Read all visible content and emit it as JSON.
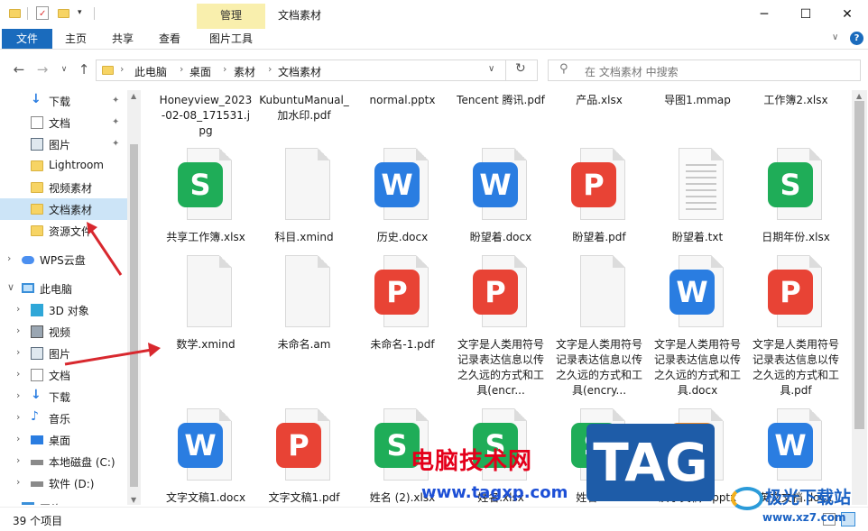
{
  "titlebar": {
    "window_title": "文档素材",
    "context_tab": "管理",
    "controls": {
      "minimize": "─",
      "maximize": "☐",
      "close": "✕"
    }
  },
  "ribbon": {
    "tabs": [
      "文件",
      "主页",
      "共享",
      "查看",
      "图片工具"
    ],
    "help_icon": "?"
  },
  "address": {
    "crumbs": [
      "此电脑",
      "桌面",
      "素材",
      "文档素材"
    ],
    "search_placeholder": "在 文档素材 中搜索"
  },
  "nav": {
    "quick": [
      {
        "label": "下载",
        "icon": "download-icon",
        "pinned": true
      },
      {
        "label": "文档",
        "icon": "document-icon",
        "pinned": true
      },
      {
        "label": "图片",
        "icon": "picture-icon",
        "pinned": true
      },
      {
        "label": "Lightroom",
        "icon": "folder-icon"
      },
      {
        "label": "视频素材",
        "icon": "folder-icon"
      },
      {
        "label": "文档素材",
        "icon": "folder-icon",
        "selected": true
      },
      {
        "label": "资源文件",
        "icon": "folder-icon"
      }
    ],
    "wps": "WPS云盘",
    "pc": "此电脑",
    "pc_items": [
      {
        "label": "3D 对象",
        "icon": "3d-objects-icon"
      },
      {
        "label": "视频",
        "icon": "video-icon"
      },
      {
        "label": "图片",
        "icon": "picture-icon"
      },
      {
        "label": "文档",
        "icon": "document-icon"
      },
      {
        "label": "下载",
        "icon": "download-icon"
      },
      {
        "label": "音乐",
        "icon": "music-icon"
      },
      {
        "label": "桌面",
        "icon": "desktop-icon"
      },
      {
        "label": "本地磁盘 (C:)",
        "icon": "drive-icon"
      },
      {
        "label": "软件 (D:)",
        "icon": "drive-icon"
      },
      {
        "label": "网络",
        "icon": "network-icon"
      }
    ]
  },
  "files": {
    "row0": [
      "Honeyview_2023-02-08_171531.jpg",
      "KubuntuManual_加水印.pdf",
      "normal.pptx",
      "Tencent 腾讯.pdf",
      "产品.xlsx",
      "导图1.mmap",
      "工作簿2.xlsx"
    ],
    "row1": [
      {
        "name": "共享工作簿.xlsx",
        "type": "S",
        "color": "#1fad58"
      },
      {
        "name": "科目.xmind",
        "type": "plain"
      },
      {
        "name": "历史.docx",
        "type": "W",
        "color": "#2a7de1"
      },
      {
        "name": "盼望着.docx",
        "type": "W",
        "color": "#2a7de1"
      },
      {
        "name": "盼望着.pdf",
        "type": "P",
        "color": "#e84335"
      },
      {
        "name": "盼望着.txt",
        "type": "txt"
      },
      {
        "name": "日期年份.xlsx",
        "type": "S",
        "color": "#1fad58"
      }
    ],
    "row2": [
      {
        "name": "数学.xmind",
        "type": "plain"
      },
      {
        "name": "未命名.am",
        "type": "plain"
      },
      {
        "name": "未命名-1.pdf",
        "type": "P",
        "color": "#e84335"
      },
      {
        "name": "文字是人类用符号记录表达信息以传之久远的方式和工具(encr...",
        "type": "P",
        "color": "#e84335"
      },
      {
        "name": "文字是人类用符号记录表达信息以传之久远的方式和工具(encry...",
        "type": "plain"
      },
      {
        "name": "文字是人类用符号记录表达信息以传之久远的方式和工具.docx",
        "type": "W",
        "color": "#2a7de1"
      },
      {
        "name": "文字是人类用符号记录表达信息以传之久远的方式和工具.pdf",
        "type": "P",
        "color": "#e84335"
      }
    ],
    "row3": [
      {
        "name": "文字文稿1.docx",
        "type": "W",
        "color": "#2a7de1"
      },
      {
        "name": "文字文稿1.pdf",
        "type": "P",
        "color": "#e84335"
      },
      {
        "name": "姓名 (2).xlsx",
        "type": "S",
        "color": "#1fad58"
      },
      {
        "name": "姓名.xlsx",
        "type": "S",
        "color": "#1fad58"
      },
      {
        "name": "姓名.xlsx",
        "type": "S",
        "color": "#1fad58"
      },
      {
        "name": "演示文稿1.pptx",
        "type": "P",
        "color": "#f08a24"
      },
      {
        "name": "英文文档.docx",
        "type": "W",
        "color": "#2a7de1"
      }
    ]
  },
  "status": {
    "count": "39 个项目"
  },
  "watermark": {
    "cn": "电脑技术网",
    "url": "www.tagxp.com",
    "tag": "TAG",
    "jg": "极光下载站",
    "jg_url": "www.xz7.com"
  },
  "colors": {
    "accent": "#1a6bbd",
    "selected": "#cce4f7",
    "arrow": "#d8282e"
  }
}
